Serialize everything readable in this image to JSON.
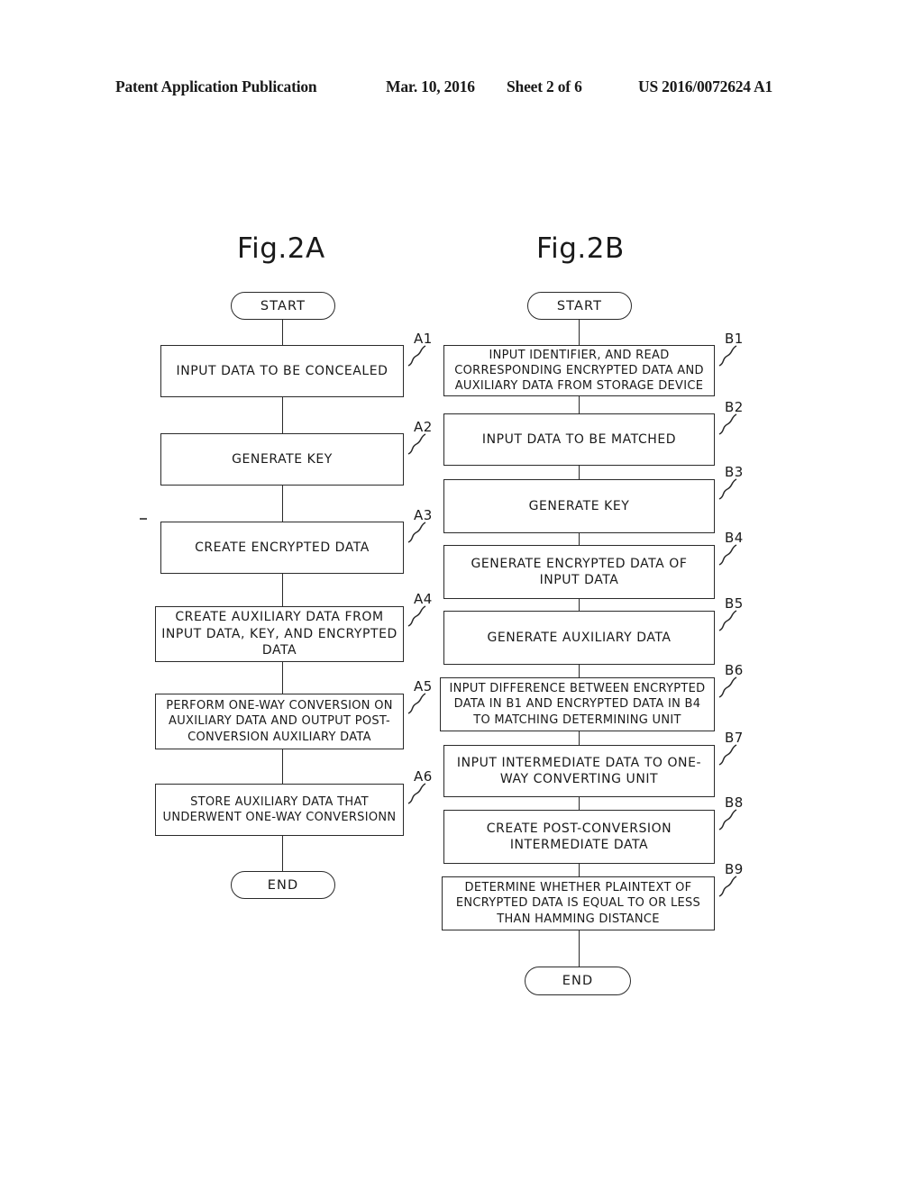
{
  "header": {
    "publication": "Patent Application Publication",
    "date": "Mar. 10, 2016",
    "sheet": "Sheet 2 of 6",
    "number": "US 2016/0072624 A1"
  },
  "figures": [
    {
      "title": "Fig.2A",
      "start_label": "START",
      "end_label": "END",
      "steps": [
        {
          "ref": "A1",
          "text": "INPUT DATA TO BE CONCEALED"
        },
        {
          "ref": "A2",
          "text": "GENERATE KEY"
        },
        {
          "ref": "A3",
          "text": "CREATE ENCRYPTED DATA"
        },
        {
          "ref": "A4",
          "text": "CREATE AUXILIARY DATA FROM INPUT DATA, KEY, AND ENCRYPTED DATA"
        },
        {
          "ref": "A5",
          "text": "PERFORM ONE-WAY CONVERSION ON AUXILIARY DATA AND OUTPUT POST-CONVERSION AUXILIARY DATA"
        },
        {
          "ref": "A6",
          "text": "STORE AUXILIARY DATA THAT UNDERWENT ONE-WAY CONVERSIONN"
        }
      ]
    },
    {
      "title": "Fig.2B",
      "start_label": "START",
      "end_label": "END",
      "steps": [
        {
          "ref": "B1",
          "text": "INPUT IDENTIFIER, AND READ CORRESPONDING ENCRYPTED DATA AND AUXILIARY DATA FROM STORAGE DEVICE"
        },
        {
          "ref": "B2",
          "text": "INPUT DATA TO BE MATCHED"
        },
        {
          "ref": "B3",
          "text": "GENERATE KEY"
        },
        {
          "ref": "B4",
          "text": "GENERATE ENCRYPTED DATA OF INPUT DATA"
        },
        {
          "ref": "B5",
          "text": "GENERATE AUXILIARY DATA"
        },
        {
          "ref": "B6",
          "text": "INPUT DIFFERENCE BETWEEN ENCRYPTED DATA IN B1 AND ENCRYPTED DATA IN B4 TO MATCHING DETERMINING UNIT"
        },
        {
          "ref": "B7",
          "text": "INPUT INTERMEDIATE DATA TO ONE-WAY CONVERTING UNIT"
        },
        {
          "ref": "B8",
          "text": "CREATE POST-CONVERSION INTERMEDIATE DATA"
        },
        {
          "ref": "B9",
          "text": "DETERMINE WHETHER PLAINTEXT OF ENCRYPTED DATA IS EQUAL TO OR LESS THAN HAMMING DISTANCE"
        }
      ]
    }
  ],
  "colors": {
    "ink": "#1a1a1a",
    "line": "#2a2a2a",
    "page": "#ffffff"
  }
}
